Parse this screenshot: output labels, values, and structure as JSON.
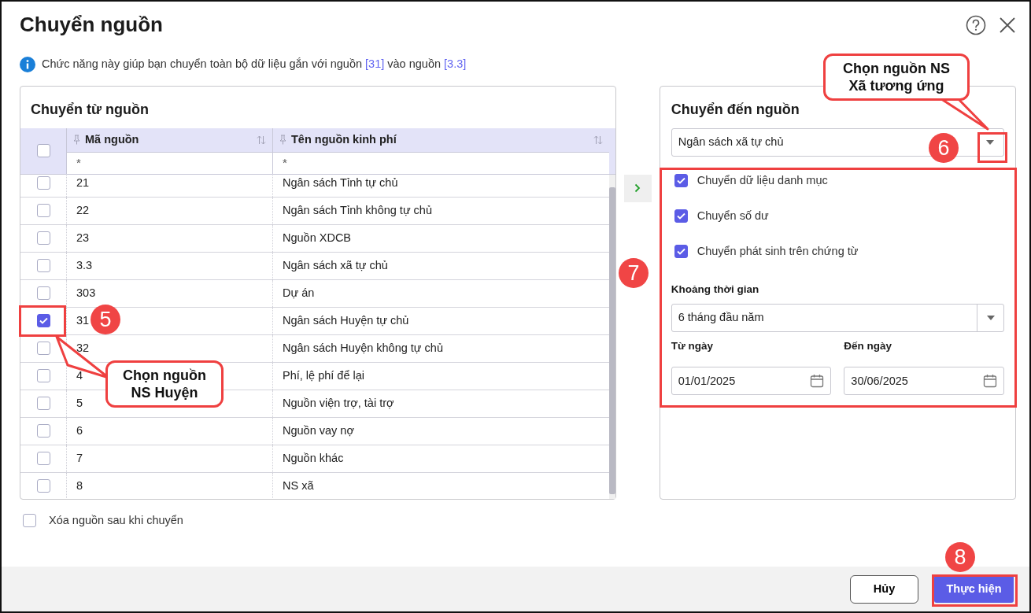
{
  "dialog": {
    "title": "Chuyển nguồn"
  },
  "info": {
    "parts": [
      {
        "kind": "text",
        "text": "Chức năng này giúp bạn chuyển toàn bộ dữ liệu gắn với nguồn "
      },
      {
        "kind": "link",
        "text": "[31]"
      },
      {
        "kind": "text",
        "text": " vào nguồn "
      },
      {
        "kind": "link",
        "text": "[3.3]"
      }
    ]
  },
  "source_panel": {
    "title": "Chuyển từ nguồn",
    "select_all": {
      "checked": false
    },
    "columns": [
      {
        "label": "Mã nguồn",
        "filter": "*"
      },
      {
        "label": "Tên nguồn kinh phí",
        "filter": "*"
      }
    ],
    "rows": [
      {
        "code": "21",
        "name": "Ngân sách Tỉnh tự chủ",
        "checked": false
      },
      {
        "code": "22",
        "name": "Ngân sách Tỉnh không tự chủ",
        "checked": false
      },
      {
        "code": "23",
        "name": "Nguồn XDCB",
        "checked": false
      },
      {
        "code": "3.3",
        "name": "Ngân sách xã tự chủ",
        "checked": false
      },
      {
        "code": "303",
        "name": "Dự án",
        "checked": false
      },
      {
        "code": "31",
        "name": "Ngân sách Huyện tự chủ",
        "checked": true
      },
      {
        "code": "32",
        "name": "Ngân sách Huyện không tự chủ",
        "checked": false
      },
      {
        "code": "4",
        "name": "Phí, lệ phí để lại",
        "checked": false
      },
      {
        "code": "5",
        "name": "Nguồn viện trợ, tài trợ",
        "checked": false
      },
      {
        "code": "6",
        "name": "Nguồn vay nợ",
        "checked": false
      },
      {
        "code": "7",
        "name": "Nguồn khác",
        "checked": false
      },
      {
        "code": "8",
        "name": "NS xã",
        "checked": false
      }
    ]
  },
  "target_panel": {
    "title": "Chuyển đến nguồn",
    "source_select": {
      "value": "Ngân sách xã tự chủ"
    },
    "options": [
      {
        "label": "Chuyển dữ liệu danh mục",
        "checked": true
      },
      {
        "label": "Chuyển số dư",
        "checked": true
      },
      {
        "label": "Chuyển phát sinh trên chứng từ",
        "checked": true
      }
    ],
    "period": {
      "label": "Khoảng thời gian",
      "value": "6 tháng đầu năm"
    },
    "from_date": {
      "label": "Từ ngày",
      "value": "01/01/2025"
    },
    "to_date": {
      "label": "Đến ngày",
      "value": "30/06/2025"
    }
  },
  "delete_after": {
    "label": "Xóa nguồn sau khi chuyển",
    "checked": false
  },
  "footer": {
    "buttons": [
      {
        "label": "Hủy",
        "kind": "secondary"
      },
      {
        "label": "Thực hiện",
        "kind": "primary"
      }
    ]
  },
  "annotations": {
    "badges": [
      {
        "label": "5"
      },
      {
        "label": "6"
      },
      {
        "label": "7"
      },
      {
        "label": "8"
      }
    ],
    "callouts": [
      {
        "text": "Chọn nguồn NS Huyện"
      },
      {
        "text": "Chọn nguồn NS Xã tương ứng"
      }
    ]
  }
}
